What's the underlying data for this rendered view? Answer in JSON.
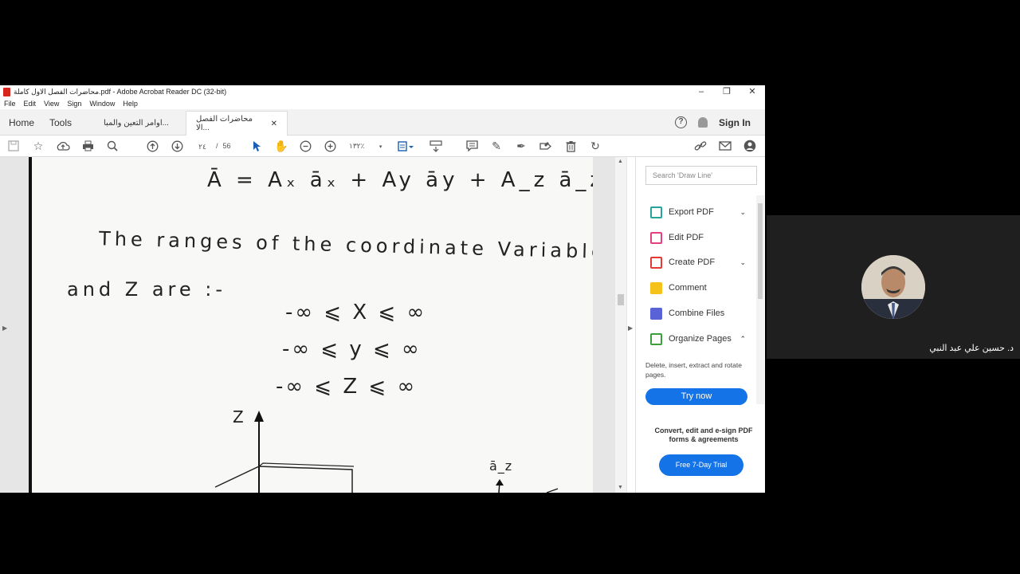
{
  "window": {
    "title": "محاضرات الفصل الاول كاملة.pdf - Adobe Acrobat Reader DC (32-bit)",
    "controls": [
      "–",
      "❐",
      "✕"
    ]
  },
  "menu": [
    "File",
    "Edit",
    "View",
    "Sign",
    "Window",
    "Help"
  ],
  "tabs": {
    "home": "Home",
    "tools": "Tools",
    "doc1": "اوامر التعين والمبا...",
    "doc2": "محاضرات الفصل الا...",
    "close": "✕",
    "help": "?",
    "signin": "Sign In"
  },
  "toolbar": {
    "page_current": "٢٤",
    "page_sep": "/",
    "page_total": "56",
    "zoom": "١٣٢٪",
    "icons": [
      "save-icon",
      "star-icon",
      "upload-icon",
      "print-icon",
      "search-icon",
      "prev-page-icon",
      "next-page-icon",
      "select-icon",
      "hand-icon",
      "zoom-out-icon",
      "zoom-in-icon",
      "fit-icon",
      "scroll-icon",
      "comment-icon",
      "pen-icon",
      "sign-icon",
      "fill-icon",
      "delete-icon",
      "rotate-icon",
      "share-link-icon",
      "email-icon",
      "account-icon"
    ]
  },
  "document": {
    "eq1": "Ā = Aₓ āₓ + Ay āy + A_z ā_z",
    "line1": "The ranges of the coordinate Variables X, y,",
    "line2": "and Z are :-",
    "ineq1": "-∞ ⩽ X ⩽ ∞",
    "ineq2": "-∞ ⩽ y ⩽ ∞",
    "ineq3": "-∞ ⩽ Z ⩽ ∞",
    "axis_z": "Z",
    "az_label": "ā_z"
  },
  "panel": {
    "search_placeholder": "Search 'Draw Line'",
    "tools": [
      {
        "label": "Export PDF",
        "color": "#26a69a",
        "chevron": "⌄"
      },
      {
        "label": "Edit PDF",
        "color": "#e5407d",
        "chevron": ""
      },
      {
        "label": "Create PDF",
        "color": "#e53935",
        "chevron": "⌄"
      },
      {
        "label": "Comment",
        "color": "#f4c21b",
        "chevron": ""
      },
      {
        "label": "Combine Files",
        "color": "#5a62d8",
        "chevron": ""
      },
      {
        "label": "Organize Pages",
        "color": "#3ba03b",
        "chevron": "⌃"
      }
    ],
    "description": "Delete, insert, extract and rotate pages.",
    "try_now": "Try now",
    "promo": "Convert, edit and e-sign PDF forms & agreements",
    "free_trial": "Free 7-Day Trial"
  },
  "webcam": {
    "name": "د. حسين علي عبد النبي"
  }
}
